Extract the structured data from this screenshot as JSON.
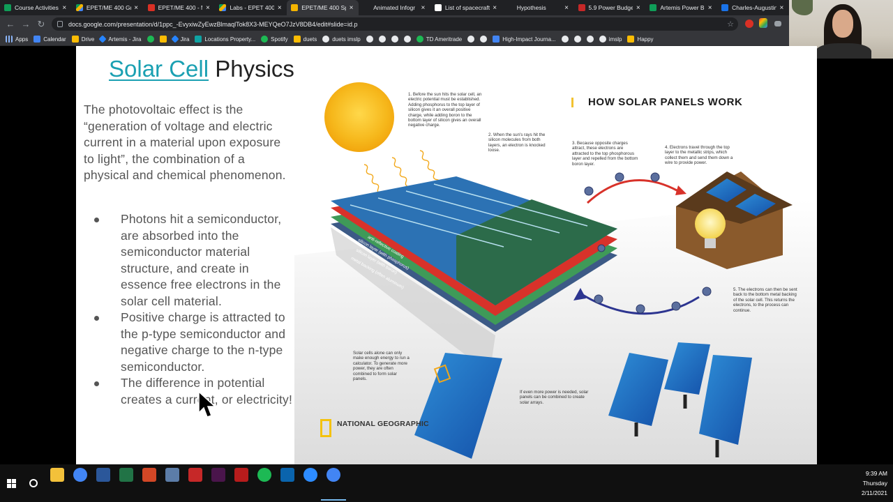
{
  "browser": {
    "tabs": [
      {
        "label": "Course Activities",
        "favicon": "sheets-icon",
        "active": false
      },
      {
        "label": "EPET/ME 400 Gr",
        "favicon": "drive-icon",
        "active": false
      },
      {
        "label": "EPET/ME 400 - M",
        "favicon": "gmail-icon",
        "active": false
      },
      {
        "label": "Labs - EPET 400",
        "favicon": "drive-icon",
        "active": false
      },
      {
        "label": "EPET/ME 400 Sp",
        "favicon": "slides-icon",
        "active": true
      },
      {
        "label": "Animated Infogr",
        "favicon": "none",
        "active": false
      },
      {
        "label": "List of spacecraft",
        "favicon": "wiki-icon",
        "active": false
      },
      {
        "label": "Hypothesis",
        "favicon": "none",
        "active": false
      },
      {
        "label": "5.9 Power Budge",
        "favicon": "pb-icon",
        "active": false
      },
      {
        "label": "Artemis Power B",
        "favicon": "sheets-icon",
        "active": false
      },
      {
        "label": "Charles-Augustin",
        "favicon": "doc-icon",
        "active": false
      }
    ],
    "close_glyph": "×",
    "url": "docs.google.com/presentation/d/1ppc_-EvyxiwZyEwzBlmaqlTok8X3-MEYQeO7JzV8DB4/edit#slide=id.p",
    "bookmarks": [
      {
        "label": "Apps",
        "icon": "apps-icon"
      },
      {
        "label": "Calendar",
        "icon": "calendar-icon"
      },
      {
        "label": "Drive",
        "icon": "drive-icon"
      },
      {
        "label": "Artemis - Jira",
        "icon": "jira-icon"
      },
      {
        "label": "",
        "icon": "leaf-icon"
      },
      {
        "label": "",
        "icon": "grid-icon"
      },
      {
        "label": "Jira",
        "icon": "jira-icon"
      },
      {
        "label": "Locations Property...",
        "icon": "location-icon"
      },
      {
        "label": "Spotify",
        "icon": "spotify-icon"
      },
      {
        "label": "duets",
        "icon": "duets-icon"
      },
      {
        "label": "duets imslp",
        "icon": "imslp-icon"
      },
      {
        "label": "",
        "icon": "bar-icon"
      },
      {
        "label": "",
        "icon": "drop-icon"
      },
      {
        "label": "",
        "icon": "circle-icon"
      },
      {
        "label": "",
        "icon": "star-icon"
      },
      {
        "label": "TD Ameritrade",
        "icon": "td-icon"
      },
      {
        "label": "",
        "icon": "globe-icon"
      },
      {
        "label": "",
        "icon": "globe-icon"
      },
      {
        "label": "High-Impact Journa...",
        "icon": "cloud-icon"
      },
      {
        "label": "",
        "icon": "globe-icon"
      },
      {
        "label": "",
        "icon": "globe-icon"
      },
      {
        "label": "",
        "icon": "globe-icon"
      },
      {
        "label": "imslp",
        "icon": "imslp-icon"
      },
      {
        "label": "Happy",
        "icon": "folder-icon"
      }
    ]
  },
  "slide": {
    "title_link": "Solar Cell",
    "title_rest": " Physics",
    "intro": "The photovoltaic effect is the “generation of voltage and electric current in a material upon exposure to light”, the combination of a physical and chemical phenomenon.",
    "bullets": [
      "Photons hit a semiconductor, are absorbed into the semiconductor material structure, and create in essence free electrons in the solar cell material.",
      "Positive charge is attracted to the p-type semiconductor and negative charge to the n-type semiconductor.",
      "The difference in potential creates a current, or electricity!"
    ]
  },
  "infographic": {
    "heading": "HOW SOLAR PANELS WORK",
    "step1": "1. Before the sun hits the solar cell, an electric potential must be established. Adding phosphorus to the top layer of silicon gives it an overall positive charge, while adding boron to the bottom layer of silicon gives an overall negative charge.",
    "step2": "2. When the sun's rays hit the silicon molecules from both layers, an electron is knocked loose.",
    "step3": "3. Because opposite charges attract, these electrons are attracted to the top phosphorous layer and repelled from the bottom boron layer.",
    "step4": "4. Electrons travel through the top layer to the metallic strips, which collect them and send them down a wire to provide power.",
    "step5": "5. The electrons can then be sent back to the bottom metal backing of the solar cell. This returns the electrons, to the process can continue.",
    "label_strips": "metal conductor strips",
    "label_layers": [
      "anti-reflective coating",
      "silicon layer (with phosphorus)",
      "silicon layer (with boron)",
      "metal backing (often aluminum)"
    ],
    "note_cells": "Solar cells alone can only make enough energy to run a calculator. To generate more power, they are often combined to form solar panels.",
    "note_arrays": "If even more power is needed, solar panels can be combined to create solar arrays.",
    "brand": "NATIONAL GEOGRAPHIC"
  },
  "taskbar": {
    "apps": [
      "file-explorer-icon",
      "chrome-icon",
      "word-icon",
      "excel-icon",
      "powerpoint-icon",
      "paint-icon",
      "acrobat-icon",
      "slack-icon",
      "autodesk-icon",
      "spotify-icon",
      "outlook-icon",
      "zoom-icon",
      "chrome-active-icon"
    ],
    "time": "9:39 AM",
    "day": "Thursday",
    "date": "2/11/2021"
  }
}
